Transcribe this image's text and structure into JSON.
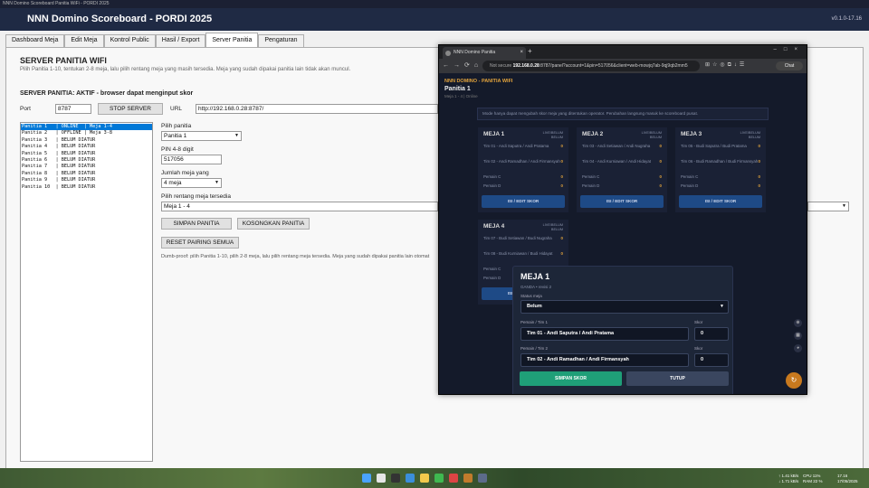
{
  "window": {
    "title": "NNN Domino Scoreboard Panitia WiFi - PORDI 2025",
    "app_title": "NNN Domino Scoreboard - PORDI 2025",
    "version": "v0.1.0-17.16"
  },
  "tabs": [
    {
      "label": "Dashboard Meja"
    },
    {
      "label": "Edit Meja"
    },
    {
      "label": "Kontrol Public"
    },
    {
      "label": "Hasil / Export"
    },
    {
      "label": "Server Panitia"
    },
    {
      "label": "Pengaturan"
    }
  ],
  "server_panel": {
    "title": "SERVER PANITIA WIFI",
    "description": "Pilih Panitia 1-10, tentukan 2-8 meja, lalu pilih rentang meja yang masih tersedia. Meja yang sudah dipakai panitia lain tidak akan muncul.",
    "status": "SERVER PANITIA: AKTIF - browser dapat menginput skor",
    "port_label": "Port",
    "port_value": "8787",
    "stop_button": "STOP SERVER",
    "url_label": "URL",
    "url_value": "http://192.168.0.28:8787/",
    "panitia_list": [
      "Panitia 1   | ONLINE  | Meja 1-4",
      "Panitia 2   | OFFLINE | Meja 3-8",
      "Panitia 3   | BELUM DIATUR",
      "Panitia 4   | BELUM DIATUR",
      "Panitia 5   | BELUM DIATUR",
      "Panitia 6   | BELUM DIATUR",
      "Panitia 7   | BELUM DIATUR",
      "Panitia 8   | BELUM DIATUR",
      "Panitia 9   | BELUM DIATUR",
      "Panitia 10  | BELUM DIATUR"
    ],
    "pilih_panitia_label": "Pilih panitia",
    "pilih_panitia_value": "Panitia 1",
    "pin_label": "PIN 4-8 digit",
    "pin_value": "517056",
    "jumlah_meja_label": "Jumlah meja yang",
    "jumlah_meja_value": "4 meja",
    "rentang_label": "Pilih rentang meja tersedia",
    "rentang_value": "Meja 1 - 4",
    "simpan_button": "SIMPAN PANITIA",
    "kosongkan_button": "KOSONGKAN PANITIA",
    "reset_button": "RESET PAIRING SEMUA",
    "hint": "Dumb-proof: pilih Panitia 1-10, pilih 2-8 meja, lalu pilih rentang meja tersedia. Meja yang sudah dipakai panitia lain otomat"
  },
  "browser": {
    "tab_title": "NNN Domino Panitia",
    "url_warning": "Not secure",
    "url_host": "192.168.0.28",
    "url_path": ":8787/panel?account=1&pin=517056&client=web-mowjq7ab-9qj9qb2mm5",
    "chat_label": "Chat",
    "brand": "NNN DOMINO - PANITIA WIFI",
    "heading": "Panitia 1",
    "subheading": "Meja 1 - 4 | Online",
    "notice": "Mode hanya dapat mengubah skor meja yang ditentukan operator. Perubahan langsung masuk ke scoreboard pusat.",
    "cards": [
      {
        "title": "MEJA 1",
        "status": [
          "LIVE/BELUM",
          "BELUM"
        ],
        "rows": [
          {
            "name": "Tim 01 - Andi Saputra / Andi Pratama",
            "score": "0"
          },
          {
            "name": "Tim 02 - Andi Ramadhan / Andi Firmansyah",
            "score": "0"
          },
          {
            "name": "Pemain C",
            "score": "0"
          },
          {
            "name": "Pemain D",
            "score": "0"
          }
        ],
        "button": "ISI / EDIT SKOR"
      },
      {
        "title": "MEJA 2",
        "status": [
          "LIVE/BELUM",
          "BELUM"
        ],
        "rows": [
          {
            "name": "Tim 03 - Andi Setiawan / Andi Nugraha",
            "score": "0"
          },
          {
            "name": "Tim 04 - Andi Kurniawan / Andi Hidayat",
            "score": "0"
          },
          {
            "name": "Pemain C",
            "score": "0"
          },
          {
            "name": "Pemain D",
            "score": "0"
          }
        ],
        "button": "ISI / EDIT SKOR"
      },
      {
        "title": "MEJA 3",
        "status": [
          "LIVE/BELUM",
          "BELUM"
        ],
        "rows": [
          {
            "name": "Tim 05 - Budi Saputra / Budi Pratama",
            "score": "0"
          },
          {
            "name": "Tim 06 - Budi Ramadhan / Budi Firmansyah",
            "score": "0"
          },
          {
            "name": "Pemain C",
            "score": "0"
          },
          {
            "name": "Pemain D",
            "score": "0"
          }
        ],
        "button": "ISI / EDIT SKOR"
      },
      {
        "title": "MEJA 4",
        "status": [
          "LIVE/BELUM",
          "BELUM"
        ],
        "rows": [
          {
            "name": "Tim 07 - Budi Setiawan / Budi Nugraha",
            "score": "0"
          },
          {
            "name": "Tim 08 - Budi Kurniawan / Budi Hidayat",
            "score": "0"
          },
          {
            "name": "Pemain C",
            "score": "0"
          },
          {
            "name": "Pemain D",
            "score": "0"
          }
        ],
        "button": "ISI / EDIT SKOR"
      }
    ],
    "modal": {
      "title": "MEJA 1",
      "subtitle": "GANDA • revisi 2",
      "status_label": "Status meja",
      "status_value": "Belum",
      "p1_label": "Pemain / Tim 1",
      "p1_value": "Tim 01 - Andi Saputra / Andi Pratama",
      "p1_score_label": "Skor",
      "p1_score": "0",
      "p2_label": "Pemain / Tim 2",
      "p2_value": "Tim 02 - Andi Ramadhan / Andi Firmansyah",
      "p2_score_label": "Skor",
      "p2_score": "0",
      "save_button": "SIMPAN SKOR",
      "close_button": "TUTUP"
    }
  },
  "taskbar": {
    "net_up": "↑ 1.41 kB/s",
    "net_down": "↓ 1.71 kB/s",
    "cpu": "CPU 11%",
    "ram": "RAM 22 %",
    "time": "17.16",
    "date": "17/05/2025"
  },
  "colors": {
    "header_bg": "#1f2a44",
    "accent": "#0078d7",
    "browser_bg": "#141a2a",
    "save_green": "#1f9f78",
    "orange": "#e2a33c"
  }
}
